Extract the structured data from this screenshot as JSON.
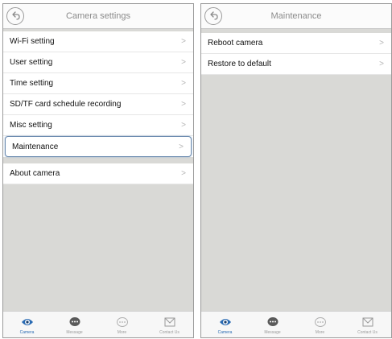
{
  "left_screen": {
    "title": "Camera settings",
    "items": [
      {
        "label": "Wi-Fi setting"
      },
      {
        "label": "User setting"
      },
      {
        "label": "Time setting"
      },
      {
        "label": "SD/TF card schedule recording"
      },
      {
        "label": "Misc setting"
      },
      {
        "label": "Maintenance"
      },
      {
        "label": "About camera"
      }
    ],
    "highlighted_item": "Maintenance"
  },
  "right_screen": {
    "title": "Maintenance",
    "items": [
      {
        "label": "Reboot camera"
      },
      {
        "label": "Restore to default"
      }
    ]
  },
  "tabbar": {
    "tabs": [
      {
        "label": "Camera",
        "icon": "eye-icon",
        "active": true
      },
      {
        "label": "Message",
        "icon": "chat-bubble-icon",
        "active": false
      },
      {
        "label": "More",
        "icon": "more-icon",
        "active": false
      },
      {
        "label": "Contact Us",
        "icon": "envelope-icon",
        "active": false
      }
    ]
  },
  "colors": {
    "accent": "#2a6bb3",
    "highlight_border": "#6c8bb0",
    "background_gray": "#d9d9d6"
  }
}
